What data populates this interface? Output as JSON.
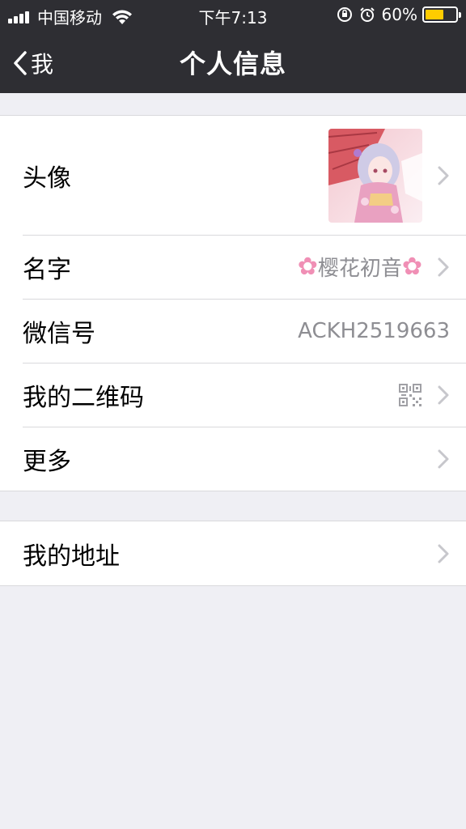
{
  "status_bar": {
    "carrier": "中国移动",
    "time": "下午7:13",
    "battery_percent": "60%",
    "battery_level": 0.6,
    "battery_color": "#ffcc00"
  },
  "nav": {
    "back_label": "我",
    "title": "个人信息"
  },
  "profile": {
    "avatar_label": "头像",
    "name_label": "名字",
    "name_value": "樱花初音",
    "name_decoration_icon": "cherry-blossom-icon",
    "wechat_id_label": "微信号",
    "wechat_id_value": "ACKH2519663",
    "qrcode_label": "我的二维码",
    "qrcode_icon": "qr-code-icon",
    "more_label": "更多"
  },
  "address": {
    "label": "我的地址"
  },
  "colors": {
    "nav_background": "#2e2e33",
    "page_background": "#efeff4",
    "secondary_text": "#8e8e93"
  }
}
